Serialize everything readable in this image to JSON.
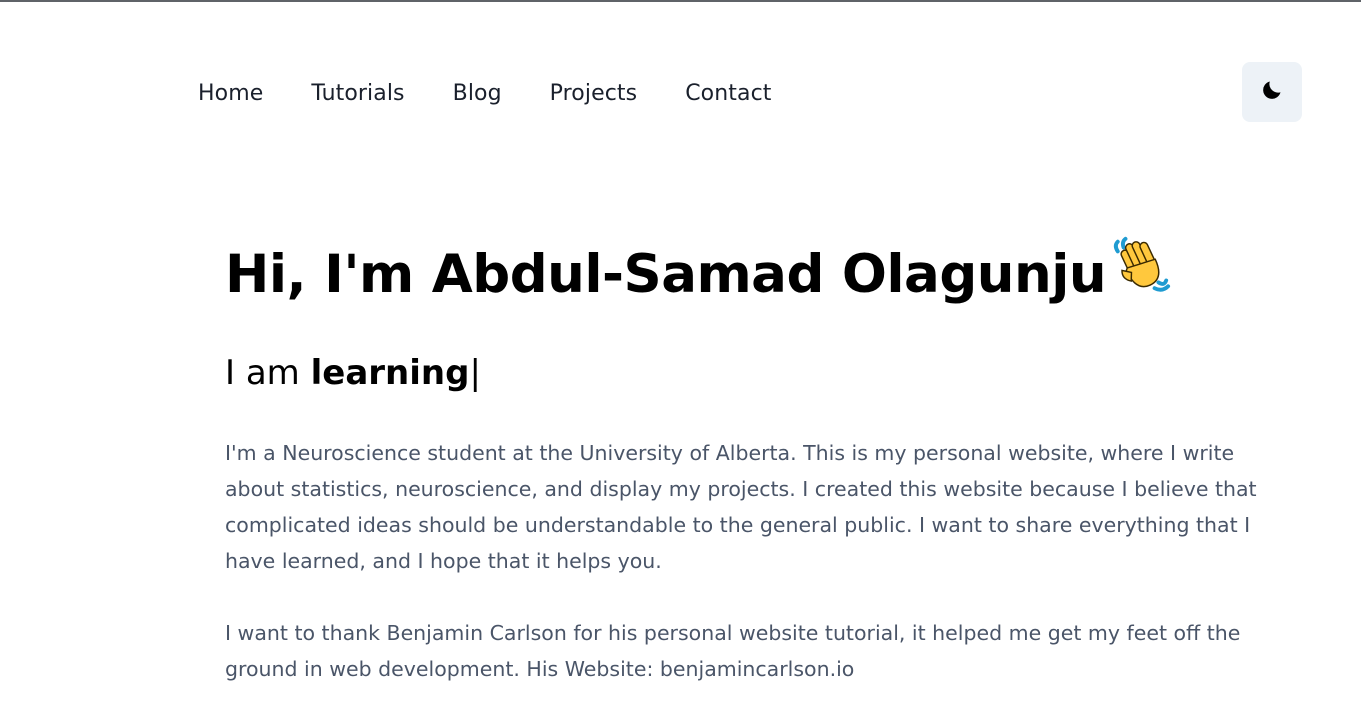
{
  "nav": {
    "items": [
      {
        "label": "Home"
      },
      {
        "label": "Tutorials"
      },
      {
        "label": "Blog"
      },
      {
        "label": "Projects"
      },
      {
        "label": "Contact"
      }
    ],
    "theme_toggle_icon": "moon-icon"
  },
  "hero": {
    "title": "Hi, I'm Abdul-Samad Olagunju",
    "wave_icon": "waving-hand-icon",
    "typing_prefix": "I am ",
    "typing_word": "learning",
    "typing_cursor": "|"
  },
  "about": {
    "paragraph1": "I'm a Neuroscience student at the University of Alberta. This is my personal website, where I write about statistics, neuroscience, and display my projects. I created this website because I believe that complicated ideas should be understandable to the general public. I want to share everything that I have learned, and I hope that it helps you.",
    "paragraph2": "I want to thank Benjamin Carlson for his personal website tutorial, it helped me get my feet off the ground in web development. His Website: benjamincarlson.io"
  },
  "colors": {
    "nav_text": "#1a202c",
    "body_text": "#4a5568",
    "toggle_bg": "#edf2f7"
  }
}
